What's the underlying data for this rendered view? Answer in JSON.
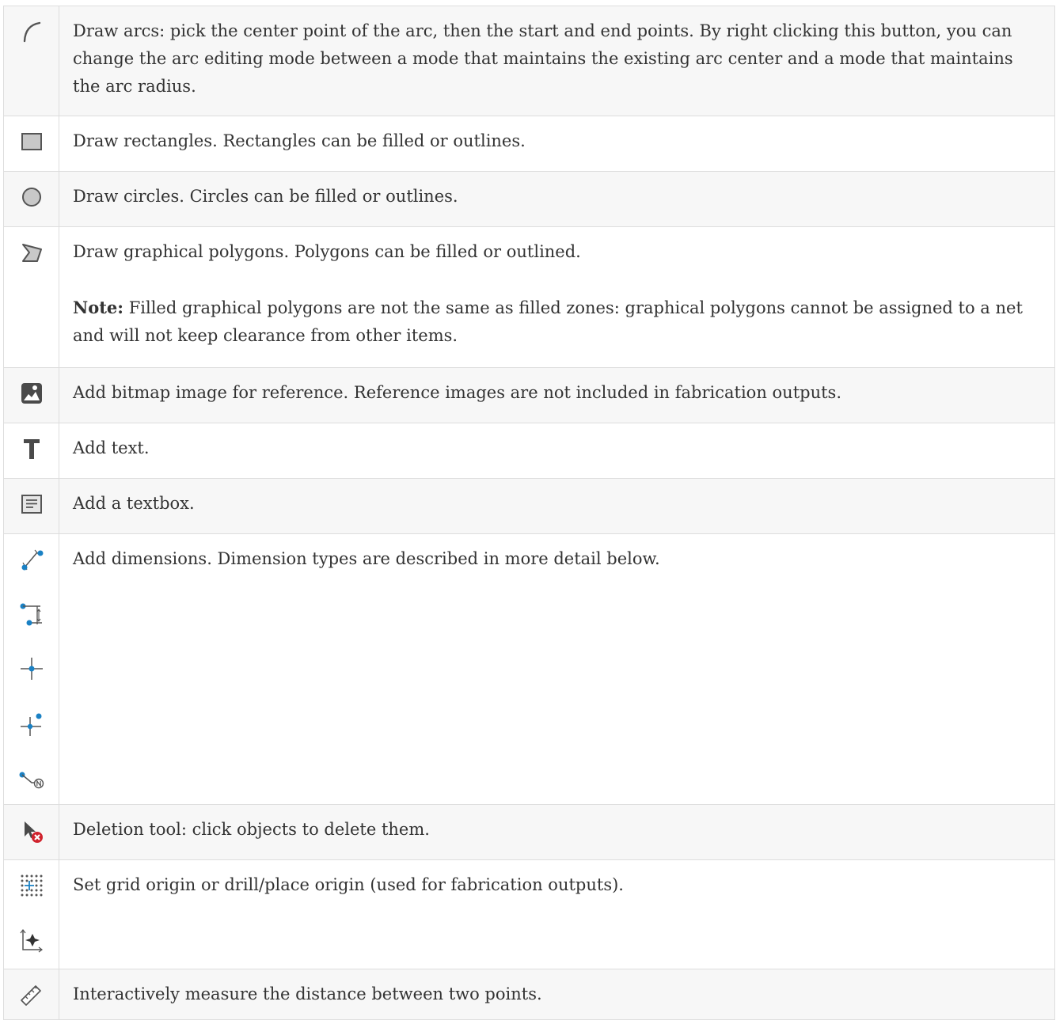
{
  "rows": [
    {
      "icons": [
        "arc-icon"
      ],
      "text": "Draw arcs: pick the center point of the arc, then the start and end points. By right clicking this button, you can change the arc editing mode between a mode that maintains the existing arc center and a mode that maintains the arc radius."
    },
    {
      "icons": [
        "rectangle-icon"
      ],
      "text": "Draw rectangles. Rectangles can be filled or outlines."
    },
    {
      "icons": [
        "circle-icon"
      ],
      "text": "Draw circles. Circles can be filled or outlines."
    },
    {
      "icons": [
        "polygon-icon"
      ],
      "text": "Draw graphical polygons. Polygons can be filled or outlined.",
      "note_label": "Note:",
      "note_text": " Filled graphical polygons are not the same as filled zones: graphical polygons cannot be assigned to a net and will not keep clearance from other items."
    },
    {
      "icons": [
        "image-icon"
      ],
      "text": "Add bitmap image for reference. Reference images are not included in fabrication outputs."
    },
    {
      "icons": [
        "text-icon"
      ],
      "text": "Add text."
    },
    {
      "icons": [
        "textbox-icon"
      ],
      "text": "Add a textbox."
    },
    {
      "icons": [
        "dimension-aligned-icon",
        "dimension-orthogonal-icon",
        "dimension-center-icon",
        "dimension-radial-icon",
        "dimension-leader-icon"
      ],
      "text": "Add dimensions. Dimension types are described in more detail below."
    },
    {
      "icons": [
        "delete-tool-icon"
      ],
      "text": "Deletion tool: click objects to delete them."
    },
    {
      "icons": [
        "grid-origin-icon",
        "drill-place-origin-icon"
      ],
      "text": "Set grid origin or drill/place origin (used for fabrication outputs)."
    },
    {
      "icons": [
        "measure-icon"
      ],
      "text": "Interactively measure the distance between two points."
    }
  ],
  "colors": {
    "icon_gray": "#555555",
    "icon_blue": "#1a81c4",
    "delete_red": "#d0232d",
    "row_alt": "#f7f7f7",
    "border": "#dddddd"
  }
}
